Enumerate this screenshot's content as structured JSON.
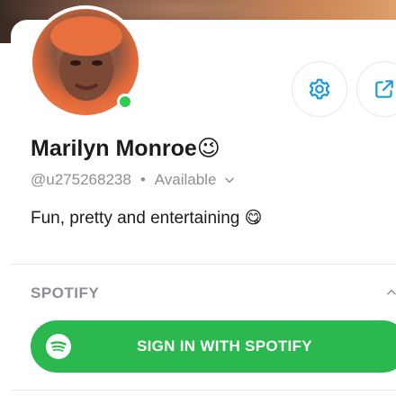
{
  "profile": {
    "name": "Marilyn Monroe😉",
    "username": "@u275268238",
    "separator": "•",
    "status": "Available",
    "bio": "Fun, pretty and entertaining 😋"
  },
  "icons": {
    "settings": "gear-icon",
    "share": "share-icon",
    "status_dropdown": "chevron-down-icon",
    "section_toggle": "chevron-up-icon",
    "spotify": "spotify-logo-icon"
  },
  "spotify_section": {
    "title": "SPOTIFY",
    "button_label": "SIGN IN WITH SPOTIFY"
  },
  "colors": {
    "accent": "#1a9ad6",
    "online": "#2ecc50",
    "spotify_green": "#2bb84f",
    "muted_text": "#8c8f96"
  }
}
